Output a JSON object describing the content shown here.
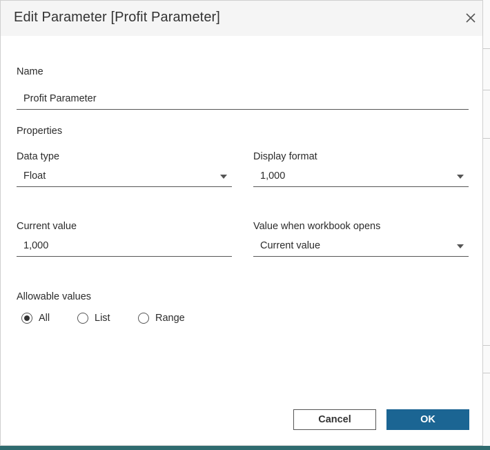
{
  "dialog": {
    "title": "Edit Parameter [Profit Parameter]",
    "close_icon": "close-icon"
  },
  "name_section": {
    "label": "Name",
    "value": "Profit Parameter"
  },
  "properties": {
    "heading": "Properties",
    "data_type": {
      "label": "Data type",
      "value": "Float"
    },
    "display_format": {
      "label": "Display format",
      "value": "1,000"
    },
    "current_value": {
      "label": "Current value",
      "value": "1,000"
    },
    "value_when_opens": {
      "label": "Value when workbook opens",
      "value": "Current value"
    }
  },
  "allowable_values": {
    "label": "Allowable values",
    "options": [
      {
        "label": "All",
        "selected": true
      },
      {
        "label": "List",
        "selected": false
      },
      {
        "label": "Range",
        "selected": false
      }
    ]
  },
  "buttons": {
    "cancel": "Cancel",
    "ok": "OK"
  },
  "colors": {
    "ok_button": "#1b6593",
    "title_bar": "#f5f5f5",
    "background_bottom": "#2f6b6f"
  }
}
